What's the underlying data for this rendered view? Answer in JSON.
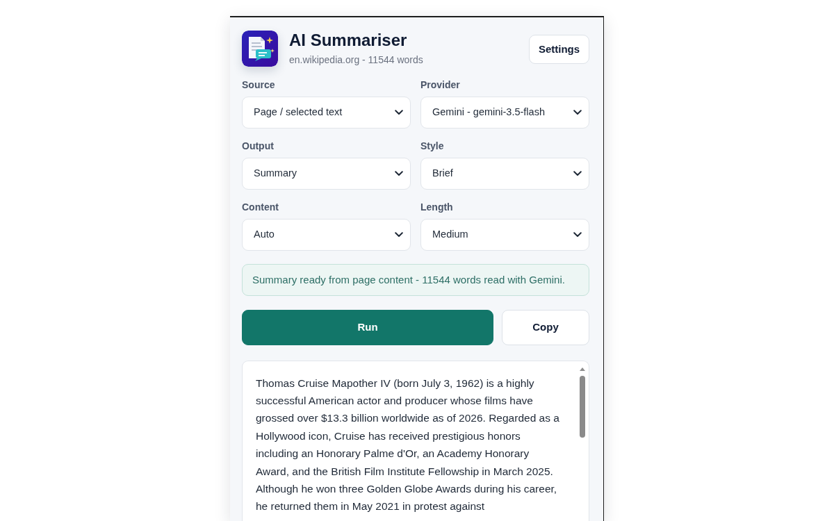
{
  "header": {
    "title": "AI Summariser",
    "subtitle": "en.wikipedia.org - 11544 words",
    "settings_button": "Settings"
  },
  "fields": [
    {
      "label": "Source",
      "value": "Page / selected text"
    },
    {
      "label": "Provider",
      "value": "Gemini - gemini-3.5-flash"
    },
    {
      "label": "Output",
      "value": "Summary"
    },
    {
      "label": "Style",
      "value": "Brief"
    },
    {
      "label": "Content",
      "value": "Auto"
    },
    {
      "label": "Length",
      "value": "Medium"
    }
  ],
  "status": "Summary ready from page content - 11544 words read with Gemini.",
  "actions": [
    {
      "label": "Run",
      "kind": "primary"
    },
    {
      "label": "Copy",
      "kind": "secondary"
    }
  ],
  "output": {
    "text": "Thomas Cruise Mapother IV (born July 3, 1962) is a highly successful American actor and producer whose films have grossed over $13.3 billion worldwide as of 2026. Regarded as a Hollywood icon, Cruise has received prestigious honors including an Honorary Palme d'Or, an Academy Honorary Award, and the British Film Institute Fellowship in March 2025. Although he won three Golden Globe Awards during his career, he returned them in May 2021 in protest against"
  }
}
